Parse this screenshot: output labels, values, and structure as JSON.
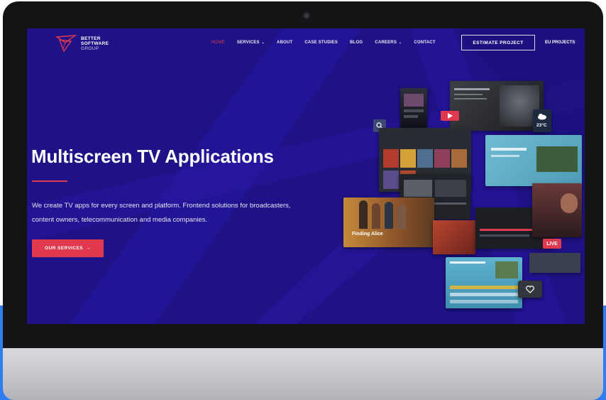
{
  "colors": {
    "screen_bg": "#1f1287",
    "accent_red": "#e0394f",
    "bezel": "#141416",
    "outer_accent_blue": "#2f7df0"
  },
  "logo": {
    "line1": "BETTER",
    "line2": "SOFTWARE",
    "line3": "GROUP"
  },
  "nav": {
    "items": [
      {
        "label": "HOME",
        "active": true
      },
      {
        "label": "SERVICES",
        "dropdown": true
      },
      {
        "label": "ABOUT"
      },
      {
        "label": "CASE STUDIES"
      },
      {
        "label": "BLOG"
      },
      {
        "label": "CAREERS",
        "dropdown": true
      },
      {
        "label": "CONTACT"
      }
    ],
    "cta": "ESTIMATE PROJECT",
    "eu_projects": "EU PROJECTS"
  },
  "hero": {
    "title": "Multiscreen TV Applications",
    "subtitle": "We create TV apps for every screen and platform. Frontend solutions for broadcasters, content owners, telecommunication and media companies.",
    "button": "OUR SERVICES",
    "button_arrow": "→"
  },
  "collage": {
    "featured_title": "Finding Alice",
    "live_badge": "LIVE",
    "temperature": "23°C",
    "icons": [
      "search-icon",
      "heart-icon",
      "play-icon",
      "cloud-icon"
    ]
  }
}
